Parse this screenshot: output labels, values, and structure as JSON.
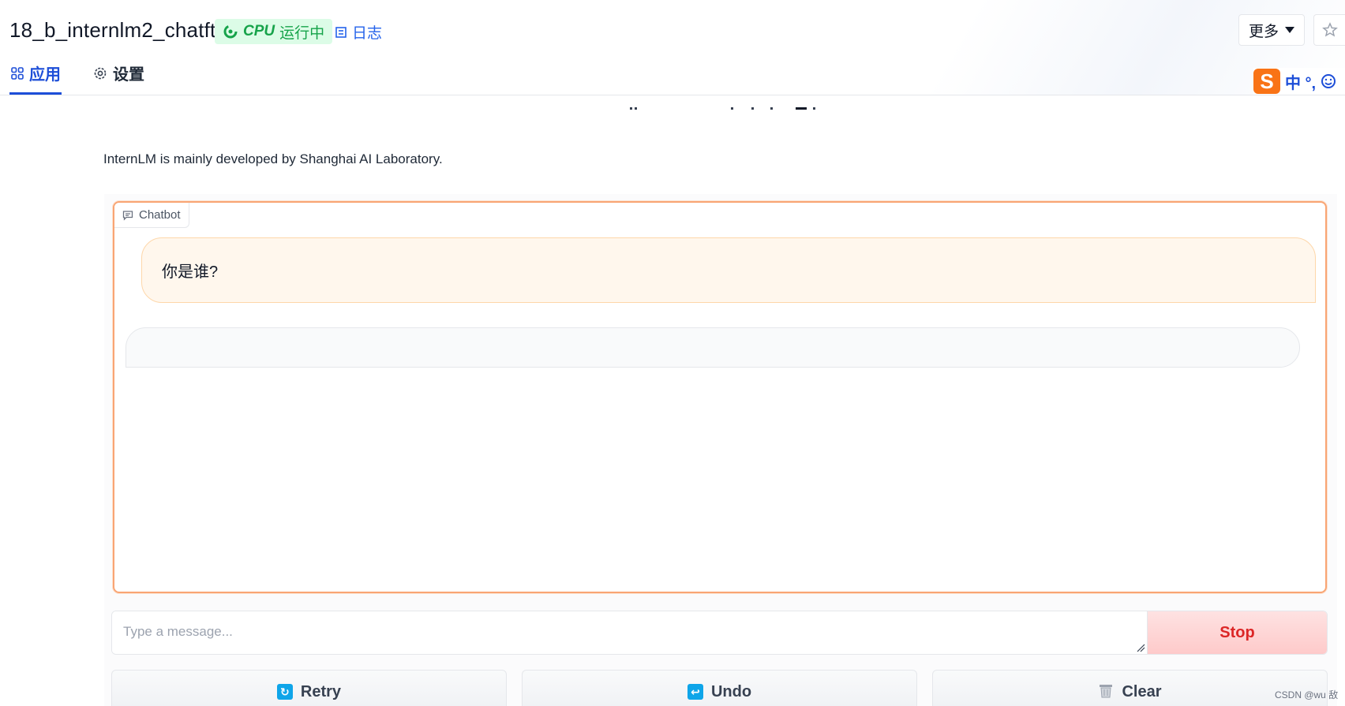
{
  "header": {
    "title": "18_b_internlm2_chatft",
    "status": {
      "hardware": "CPU",
      "state": "运行中",
      "color": "#16a34a"
    },
    "logs_label": "日志",
    "more_label": "更多"
  },
  "tabs": [
    {
      "label": "应用",
      "active": true
    },
    {
      "label": "设置",
      "active": false
    }
  ],
  "ime": {
    "logo": "S",
    "text": "中 °,"
  },
  "description": "InternLM is mainly developed by Shanghai AI Laboratory.",
  "chatbot": {
    "label": "Chatbot",
    "messages": [
      {
        "role": "user",
        "text": "你是谁?"
      },
      {
        "role": "assistant",
        "text": ""
      }
    ],
    "accent": "#f9a574"
  },
  "input": {
    "placeholder": "Type a message...",
    "value": ""
  },
  "buttons": {
    "stop": "Stop",
    "retry": "Retry",
    "undo": "Undo",
    "clear": "Clear"
  },
  "watermark": "CSDN @wu 敌"
}
